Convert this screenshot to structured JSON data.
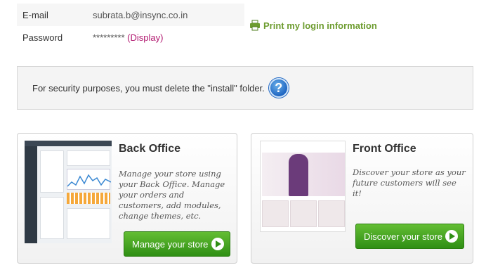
{
  "credentials": {
    "email_label": "E-mail",
    "email_value": "subrata.b@insync.co.in",
    "password_label": "Password",
    "password_value": "*********",
    "display_link_open": "(",
    "display_link_label": "Display",
    "display_link_close": ")"
  },
  "print_link": {
    "label": "Print my login information",
    "icon": "printer-icon"
  },
  "security": {
    "message": "For security purposes, you must delete the \"install\" folder.",
    "help_icon": "?"
  },
  "back_office": {
    "title": "Back Office",
    "description": "Manage your store using your Back Office. Manage your orders and customers, add modules, change themes, etc.",
    "button_label": "Manage your store"
  },
  "front_office": {
    "title": "Front Office",
    "description": "Discover your store as your future customers will see it!",
    "button_label": "Discover your store"
  },
  "colors": {
    "accent_green": "#6d9c2f",
    "button_green": "#2f8f14",
    "link_pink": "#b1176f",
    "help_blue": "#1f66c2"
  }
}
